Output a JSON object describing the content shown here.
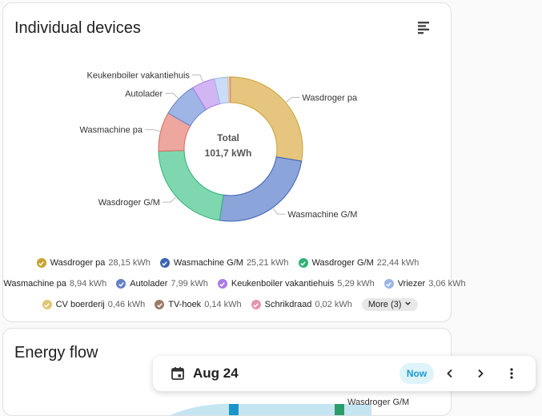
{
  "card1": {
    "title": "Individual devices",
    "view_icon": "sort-bars-icon"
  },
  "chart_data": {
    "type": "pie",
    "variant": "donut",
    "center_label": "Total",
    "center_value": "101,7 kWh",
    "series": [
      {
        "name": "Wasdroger pa",
        "value": 28.15,
        "display": "28,15 kWh",
        "color": "#e6c57e",
        "stroke": "#c9a136",
        "label": "Wasdroger pa"
      },
      {
        "name": "Wasmachine G/M",
        "value": 25.21,
        "display": "25,21 kWh",
        "color": "#8ba5db",
        "stroke": "#3b62b3",
        "label": "Wasmachine G/M"
      },
      {
        "name": "Wasdroger G/M",
        "value": 22.44,
        "display": "22,44 kWh",
        "color": "#7fd7b0",
        "stroke": "#2fb377",
        "label": "Wasdroger G/M"
      },
      {
        "name": "Wasmachine pa",
        "value": 8.94,
        "display": "8,94 kWh",
        "color": "#eda79f",
        "stroke": "#d96a5c",
        "label": "Wasmachine pa"
      },
      {
        "name": "Autolader",
        "value": 7.99,
        "display": "7,99 kWh",
        "color": "#9fb5e5",
        "stroke": "#6580c4",
        "label": "Autolader"
      },
      {
        "name": "Keukenboiler vakantiehuis",
        "value": 5.29,
        "display": "5,29 kWh",
        "color": "#d2b6f4",
        "stroke": "#a97ae6",
        "label": "Keukenboiler vakantiehuis"
      },
      {
        "name": "Vriezer",
        "value": 3.06,
        "display": "3,06 kWh",
        "color": "#cbdcf8",
        "stroke": "#9ab6e6",
        "label": ""
      },
      {
        "name": "CV boerderij",
        "value": 0.46,
        "display": "0,46 kWh",
        "color": "#f6e3b3",
        "stroke": "#e2c474",
        "label": ""
      },
      {
        "name": "TV-hoek",
        "value": 0.14,
        "display": "0,14 kWh",
        "color": "#c8b2a6",
        "stroke": "#9c7b69",
        "label": ""
      },
      {
        "name": "Schrikdraad",
        "value": 0.02,
        "display": "0,02 kWh",
        "color": "#f6c4d2",
        "stroke": "#e694ab",
        "label": ""
      }
    ]
  },
  "legend": {
    "more_label": "More (3)"
  },
  "card2": {
    "title": "Energy flow",
    "flow_label": "Wasdroger G/M"
  },
  "bottom_bar": {
    "date": "Aug 24",
    "now_label": "Now",
    "calendar_icon": "calendar-icon",
    "prev_icon": "chevron-left-icon",
    "next_icon": "chevron-right-icon",
    "menu_icon": "more-vert-icon"
  }
}
